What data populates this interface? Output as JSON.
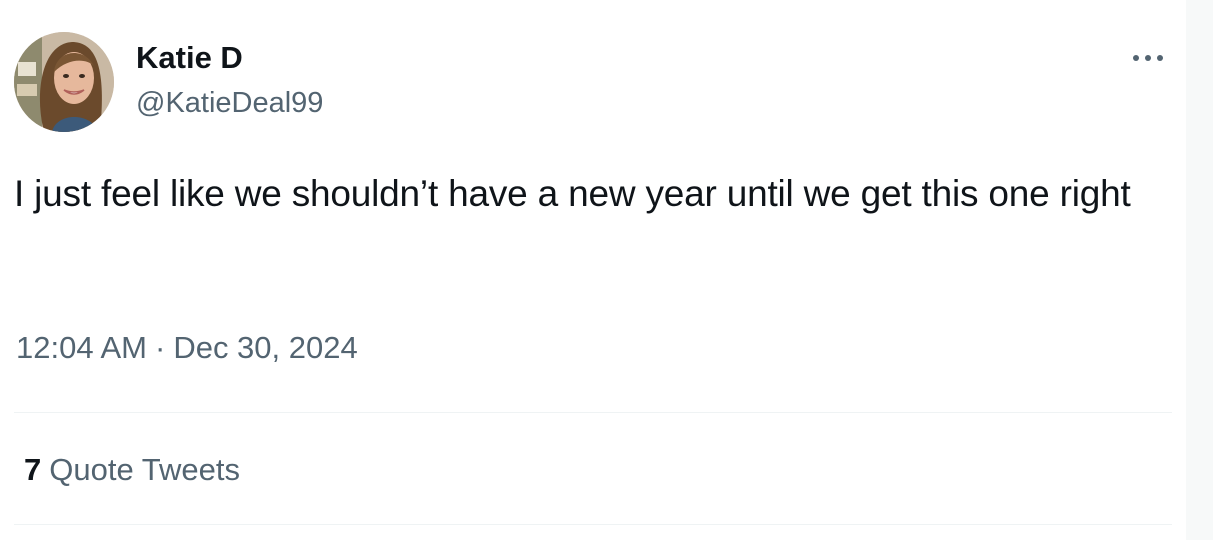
{
  "author": {
    "display_name": "Katie D",
    "handle": "@KatieDeal99"
  },
  "tweet": {
    "text": "I just feel like we shouldn’t have a new year until we get this one right",
    "time": "12:04 AM",
    "separator": "·",
    "date": "Dec 30, 2024"
  },
  "engagement": {
    "quote_count": "7",
    "quote_label": "Quote Tweets"
  },
  "icons": {
    "more": "more-horizontal-icon",
    "avatar": "profile-photo"
  },
  "colors": {
    "primary_text": "#0f1419",
    "secondary_text": "#536471",
    "divider": "#eff3f4"
  }
}
